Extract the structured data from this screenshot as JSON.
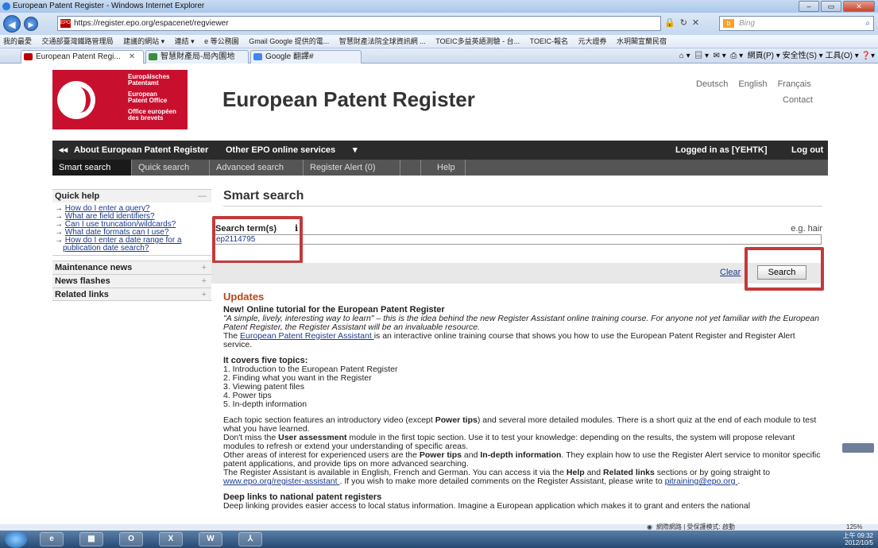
{
  "window": {
    "title": "European Patent Register - Windows Internet Explorer"
  },
  "browser": {
    "url": "https://register.epo.org/espacenet/regviewer",
    "search_engine": "Bing",
    "favorites": [
      "我的最愛",
      "交通部臺灣鐵路管理局",
      "建議的網站 ▾",
      "連結 ▾",
      "e 等公務園",
      "Gmail Google 提供的電...",
      "智慧財產法院全球資訊網 ...",
      "TOEIC多益英語測驗 - 台...",
      "TOEIC-報名",
      "元大證券",
      "水玥閣宣蘭民宿"
    ],
    "tabs": [
      "European Patent Regi...",
      "智慧財產局-局內園地",
      "Google 翻譯#"
    ],
    "commands": "網頁(P) ▾  安全性(S) ▾  工具(O) ▾",
    "status": "網際網路 | 受保護模式: 啟動",
    "zoom": "125%"
  },
  "header": {
    "logo_lines": [
      "Europäisches",
      "Patentamt",
      "European",
      "Patent Office",
      "Office européen",
      "des brevets"
    ],
    "title": "European Patent Register",
    "languages": [
      "Deutsch",
      "English",
      "Français"
    ],
    "contact": "Contact"
  },
  "blackbar": {
    "about": "About European Patent Register",
    "other": "Other EPO online services",
    "logged_in": "Logged in as [YEHTK]",
    "logout": "Log out"
  },
  "nav": {
    "tabs": [
      "Smart search",
      "Quick search",
      "Advanced search",
      "Register Alert (0)",
      "Help"
    ]
  },
  "sidebar": {
    "quick_help": "Quick help",
    "quick_help_links": [
      "How do I enter a query?",
      "What are field identifiers?",
      "Can I use truncation/wildcards?",
      "What date formats can I use?",
      "How do I enter a date range for a",
      "publication date search?"
    ],
    "maintenance": "Maintenance news",
    "news": "News flashes",
    "related": "Related links"
  },
  "main": {
    "title": "Smart search",
    "search_label": "Search term(s)",
    "info": "i",
    "example": "e.g. hair",
    "search_value": "ep2114795",
    "clear": "Clear",
    "search_button": "Search"
  },
  "updates": {
    "title": "Updates",
    "h1": "New! Online tutorial for the European Patent Register",
    "p1a": "\"A simple, lively, interesting way to learn\" – this is the idea behind the new Register Assistant online training course. For anyone not yet familiar with the European Patent Register, the Register Assistant will be an invaluable resource.",
    "p1b_pre": "The ",
    "p1b_link": "European Patent Register Assistant ",
    "p1b_post": "is an interactive online training course that shows you how to use the European Patent Register and Register Alert service.",
    "h2": "It covers five topics:",
    "topics": [
      "1. Introduction to the European Patent Register",
      "2. Finding what you want in the Register",
      "3. Viewing patent files",
      "4. Power tips",
      "5. In-depth information"
    ],
    "p3_a": "Each topic section features an introductory video (except ",
    "p3_b": "Power tips",
    "p3_c": ") and several more detailed modules. There is a short quiz at the end of each module to test what you have learned.",
    "p4_a": "Don't miss the ",
    "p4_b": "User assessment",
    "p4_c": " module in the first topic section. Use it to test your knowledge: depending on the results, the system will propose relevant modules to refresh or extend your understanding of specific areas.",
    "p5_a": "Other areas of interest for experienced users are the ",
    "p5_b": "Power tips",
    "p5_c": " and ",
    "p5_d": "In-depth information",
    "p5_e": ". They explain how to use the Register Alert service to monitor specific patent applications, and provide tips on more advanced searching.",
    "p6_a": "The Register Assistant is available in English, French and German. You can access it via the ",
    "p6_b": "Help",
    "p6_c": " and ",
    "p6_d": "Related links",
    "p6_e": " sections or by going straight to ",
    "p6_link1": "www.epo.org/register-assistant ",
    "p6_f": ". If you wish to make more detailed comments on the Register Assistant, please write to ",
    "p6_link2": "pitraining@epo.org ",
    "p6_g": ".",
    "h3": "Deep links to national patent registers",
    "p7": "Deep linking provides easier access to local status information. Imagine a European application which makes it to grant and enters the national"
  },
  "taskbar": {
    "time": "上午 09:32",
    "date": "2012/10/5"
  }
}
